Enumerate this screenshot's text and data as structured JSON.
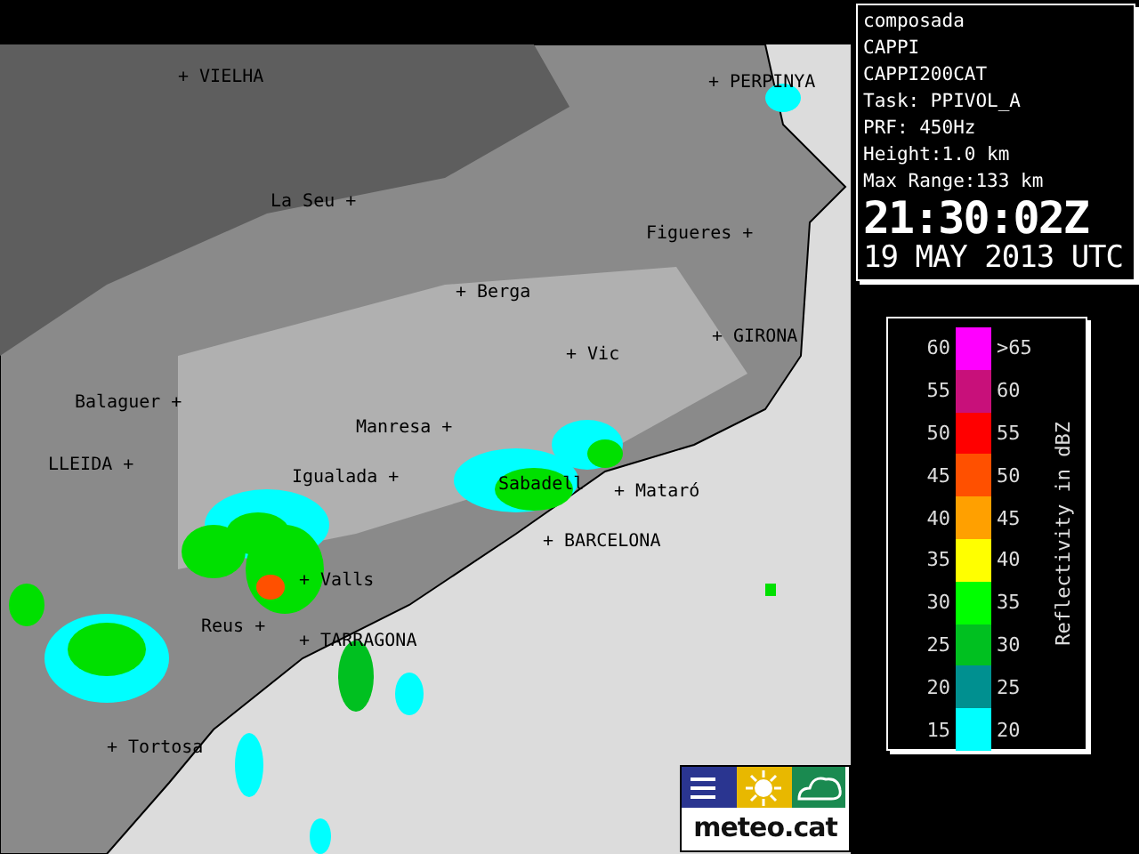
{
  "info_panel": {
    "lines": [
      "composada",
      "CAPPI",
      "CAPPI200CAT",
      "Task: PPIVOL_A",
      "PRF: 450Hz",
      "Height:1.0 km",
      "Max Range:133 km"
    ],
    "time": "21:30:02Z",
    "date": "19 MAY 2013 UTC"
  },
  "legend": {
    "title": "Reflectivity in dBZ",
    "rows": [
      {
        "low": "60",
        "high": ">65",
        "color": "#ff00ff"
      },
      {
        "low": "55",
        "high": "60",
        "color": "#c8107a"
      },
      {
        "low": "50",
        "high": "55",
        "color": "#ff0000"
      },
      {
        "low": "45",
        "high": "50",
        "color": "#ff5000"
      },
      {
        "low": "40",
        "high": "45",
        "color": "#ffa000"
      },
      {
        "low": "35",
        "high": "40",
        "color": "#ffff00"
      },
      {
        "low": "30",
        "high": "35",
        "color": "#00ff00"
      },
      {
        "low": "25",
        "high": "30",
        "color": "#00c020"
      },
      {
        "low": "20",
        "high": "25",
        "color": "#009090"
      },
      {
        "low": "15",
        "high": "20",
        "color": "#00ffff"
      }
    ]
  },
  "map": {
    "places": [
      "+ VIELHA",
      "+ PERPINYA",
      "La Seu +",
      "Figueres +",
      "+ Berga",
      "+ Vic",
      "+ GIRONA",
      "Balaguer +",
      "Manresa +",
      "LLEIDA +",
      "Igualada +",
      "Sabadell",
      "+ Mataró",
      "+ BARCELONA",
      "+ Valls",
      "Reus +",
      "+ TARRAGONA",
      "+ Tortosa"
    ]
  },
  "logo": {
    "text": "meteo.cat"
  }
}
